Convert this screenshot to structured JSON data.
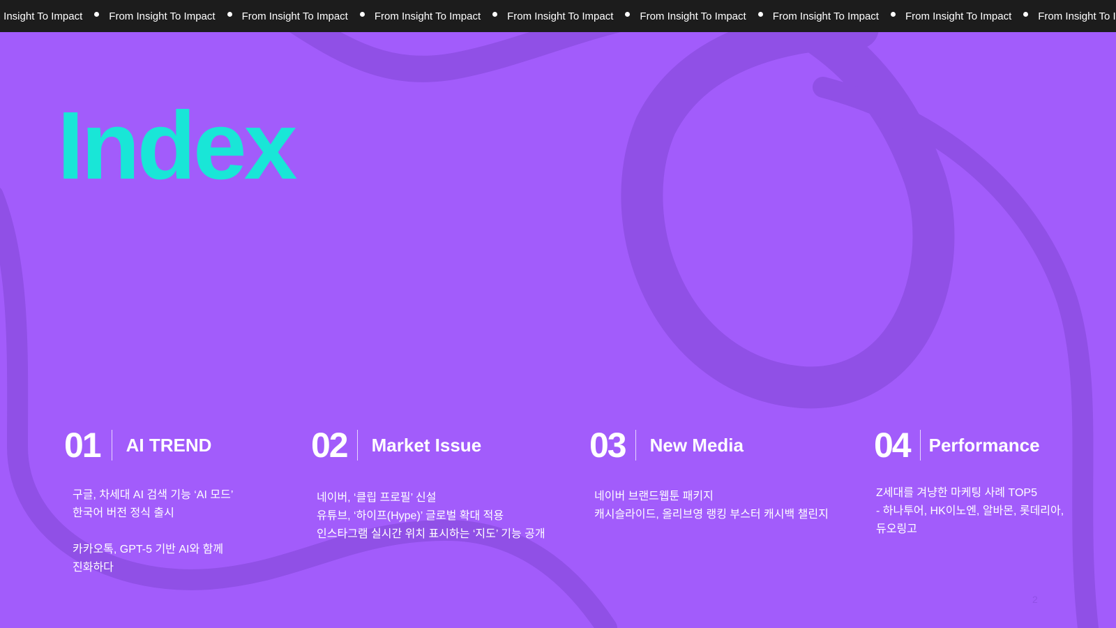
{
  "ticker": {
    "items": [
      "From Insight To Impact",
      "From Insight To Impact",
      "From Insight To Impact",
      "From Insight To Impact",
      "From Insight To Impact",
      "From Insight To Impact",
      "From Insight To Impact",
      "From Insight To Impact",
      "From Insight To Impact"
    ]
  },
  "title": "Index",
  "sections": [
    {
      "number": "01",
      "title": "AI TREND",
      "lines": [
        "구글, 차세대 AI 검색 기능 ‘AI 모드’",
        "한국어 버전 정식 출시",
        "카카오톡, GPT-5 기반 AI와 함께",
        "진화하다"
      ]
    },
    {
      "number": "02",
      "title": "Market Issue",
      "lines": [
        "네이버, ‘클립 프로필’ 신설",
        "유튜브, ‘하이프(Hype)’ 글로벌 확대 적용",
        "인스타그램 실시간 위치 표시하는 ‘지도’ 기능 공개"
      ]
    },
    {
      "number": "03",
      "title": "New Media",
      "lines": [
        "네이버 브랜드웹툰 패키지",
        "캐시슬라이드, 올리브영 랭킹 부스터 캐시백 챌린지"
      ]
    },
    {
      "number": "04",
      "title": "Performance",
      "lines": [
        "Z세대를 겨냥한 마케팅 사례 TOP5",
        "- 하나투어, HK이노엔, 알바몬, 롯데리아,",
        "듀오링고"
      ]
    }
  ],
  "page_number": "2",
  "colors": {
    "background": "#a25cfb",
    "accent_title": "#19e6d7",
    "ticker_bg": "#1c1c1c",
    "deco_stroke": "#9050e6"
  }
}
